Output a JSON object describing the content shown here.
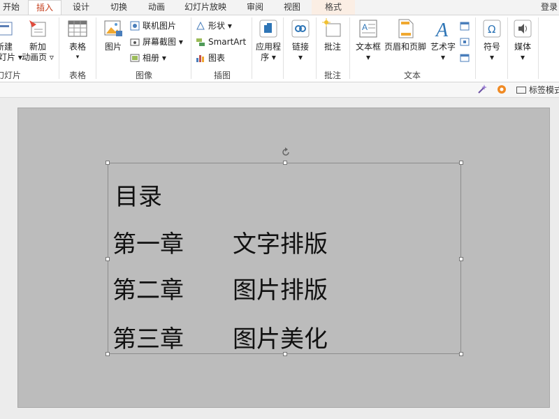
{
  "tabs": [
    {
      "label": "开始",
      "active": false
    },
    {
      "label": "插入",
      "active": true
    },
    {
      "label": "设计",
      "active": false
    },
    {
      "label": "切换",
      "active": false
    },
    {
      "label": "动画",
      "active": false
    },
    {
      "label": "幻灯片放映",
      "active": false
    },
    {
      "label": "审阅",
      "active": false
    },
    {
      "label": "视图",
      "active": false
    },
    {
      "label": "格式",
      "active": false,
      "context": true
    }
  ],
  "login": "登录",
  "ribbon": {
    "slides": {
      "new_slide_label": "新建\n幻灯片 ▾",
      "new_anim_label": "新加\n动画页 ▿",
      "group": "幻灯片"
    },
    "table": {
      "label": "表格",
      "group": "表格"
    },
    "images": {
      "picture": "图片",
      "online_picture": "联机图片",
      "screenshot": "屏幕截图 ▾",
      "album": "相册 ▾",
      "group": "图像"
    },
    "illustrations": {
      "shapes": "形状 ▾",
      "smartart": "SmartArt",
      "chart": "图表",
      "group": "插图"
    },
    "apps": {
      "label": "应用程\n序 ▾"
    },
    "links": {
      "label": "链接\n▾"
    },
    "comments": {
      "label": "批注",
      "group": "批注"
    },
    "text": {
      "textbox": "文本框\n▾",
      "header_footer": "页眉和页脚",
      "wordart": "艺术字\n▾",
      "group": "文本"
    },
    "symbols": {
      "label": "符号\n▾"
    },
    "media": {
      "label": "媒体\n▾"
    }
  },
  "toolbar2": {
    "tag_label": "标签模式"
  },
  "slide": {
    "title": "目录",
    "rows": [
      {
        "chapter": "第一章",
        "topic": "文字排版"
      },
      {
        "chapter": "第二章",
        "topic": "图片排版"
      },
      {
        "chapter": "第三章",
        "topic": "图片美化"
      }
    ]
  },
  "colors": {
    "accent": "#c43e1c",
    "slide_bg": "#bcbcbc",
    "ribbon_bg": "#ffffff"
  }
}
